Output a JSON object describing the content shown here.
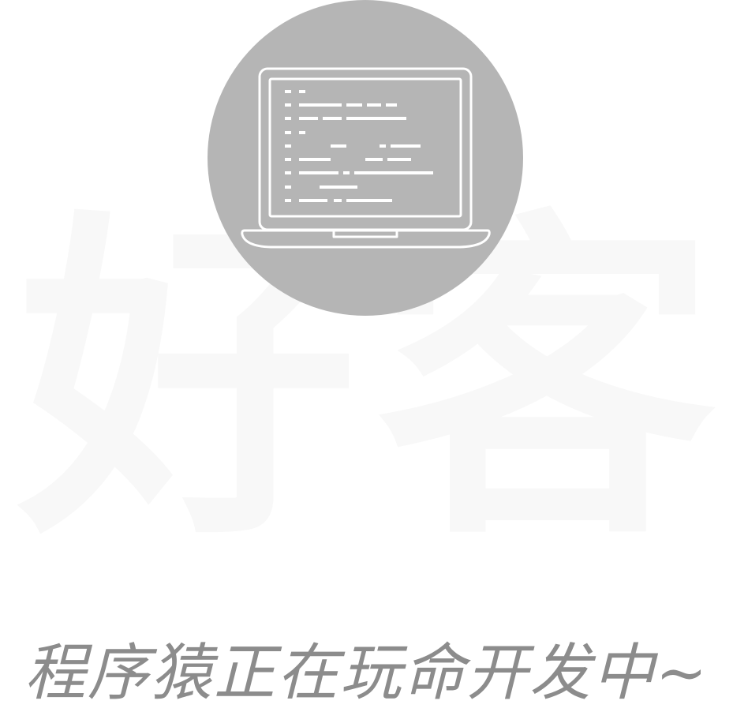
{
  "watermark": {
    "char1": "好",
    "char2": "客"
  },
  "caption": {
    "text": "程序猿正在玩命开发中~"
  },
  "icon": {
    "name": "laptop-code-icon"
  },
  "colors": {
    "circle": "#b5b5b5",
    "icon_stroke": "#ffffff",
    "watermark": "#f8f8f8",
    "caption": "#8c8c8c",
    "background": "#ffffff"
  }
}
